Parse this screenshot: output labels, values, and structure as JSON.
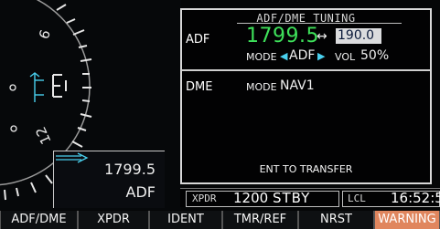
{
  "hsi": {
    "bearing_frequency": "1799.5",
    "bearing_source": "ADF"
  },
  "tuning_window": {
    "title": "ADF/DME TUNING",
    "adf": {
      "label": "ADF",
      "active_frequency": "1799.5",
      "swap_symbol": "↔",
      "standby_frequency": "190.0",
      "mode_label": "MODE",
      "mode_value": "ADF",
      "volume_label": "VOL",
      "volume_value": "50%"
    },
    "dme": {
      "label": "DME",
      "mode_label": "MODE",
      "mode_value": "NAV1"
    },
    "instruction": "ENT TO TRANSFER"
  },
  "status_bar": {
    "xpdr_label": "XPDR",
    "squawk_code": "1200",
    "xpdr_mode": "STBY",
    "time_reference": "LCL",
    "time_value": "16:52:5"
  },
  "softkeys": [
    "ADF/DME",
    "XPDR",
    "IDENT",
    "TMR/REF",
    "NRST",
    "WARNING"
  ],
  "colors": {
    "active_frequency": "#3ee05a",
    "cyan_annunciation": "#49d0ee",
    "warning_softkey": "#e0865e",
    "standby_box": "#dbdcde"
  }
}
